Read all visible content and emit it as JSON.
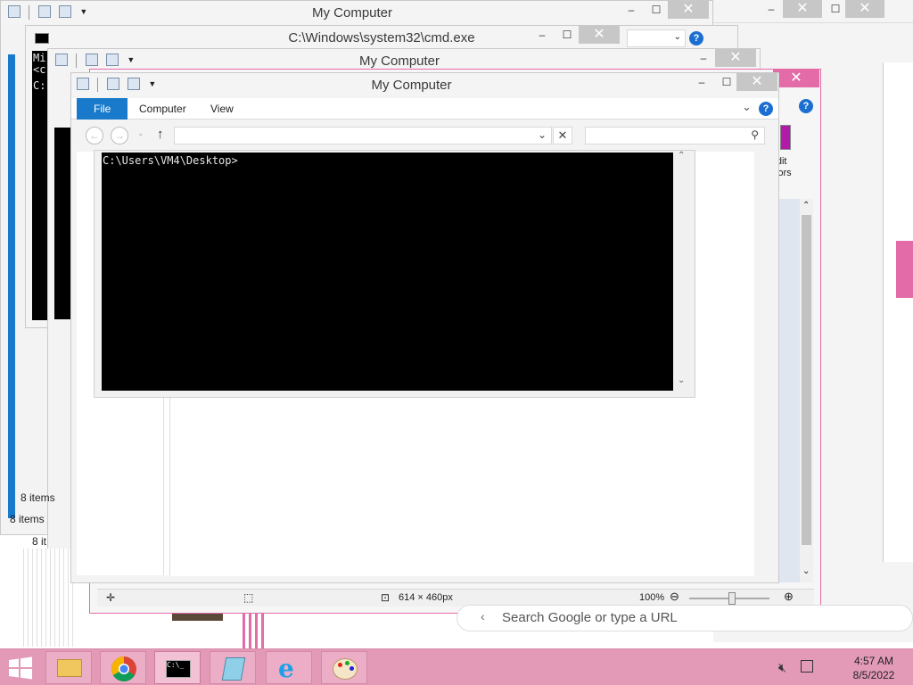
{
  "windows": {
    "back_explorer": {
      "title": "My Computer",
      "status": "8 items"
    },
    "cmd_back": {
      "title": "C:\\Windows\\system32\\cmd.exe",
      "lines": [
        "Mi",
        "<c",
        "C:"
      ]
    },
    "mid_explorer": {
      "title": "My Computer",
      "status": "8 items"
    },
    "mid_explorer2": {
      "status": "8 it"
    },
    "front_explorer": {
      "title": "My Computer",
      "tabs": [
        "File",
        "Computer",
        "View"
      ],
      "address_value": "",
      "search_placeholder": ""
    },
    "front_console": {
      "prompt": "C:\\Users\\VM4\\Desktop>"
    },
    "paint": {
      "edit_colors": "Edit\ncolors",
      "status_dims": "614 × 460px",
      "zoom": "100%"
    },
    "chrome": {
      "omnibox_placeholder": "Search Google or type a URL"
    }
  },
  "taskbar": {
    "items": [
      "file-explorer",
      "chrome",
      "command-prompt",
      "notepad",
      "internet-explorer",
      "paint"
    ],
    "time": "4:57 AM",
    "date": "8/5/2022"
  },
  "colors": {
    "accent": "#1979ca",
    "taskbar": "#e39ab7",
    "paint_border": "#e36ca8",
    "console_bg": "#000000"
  }
}
